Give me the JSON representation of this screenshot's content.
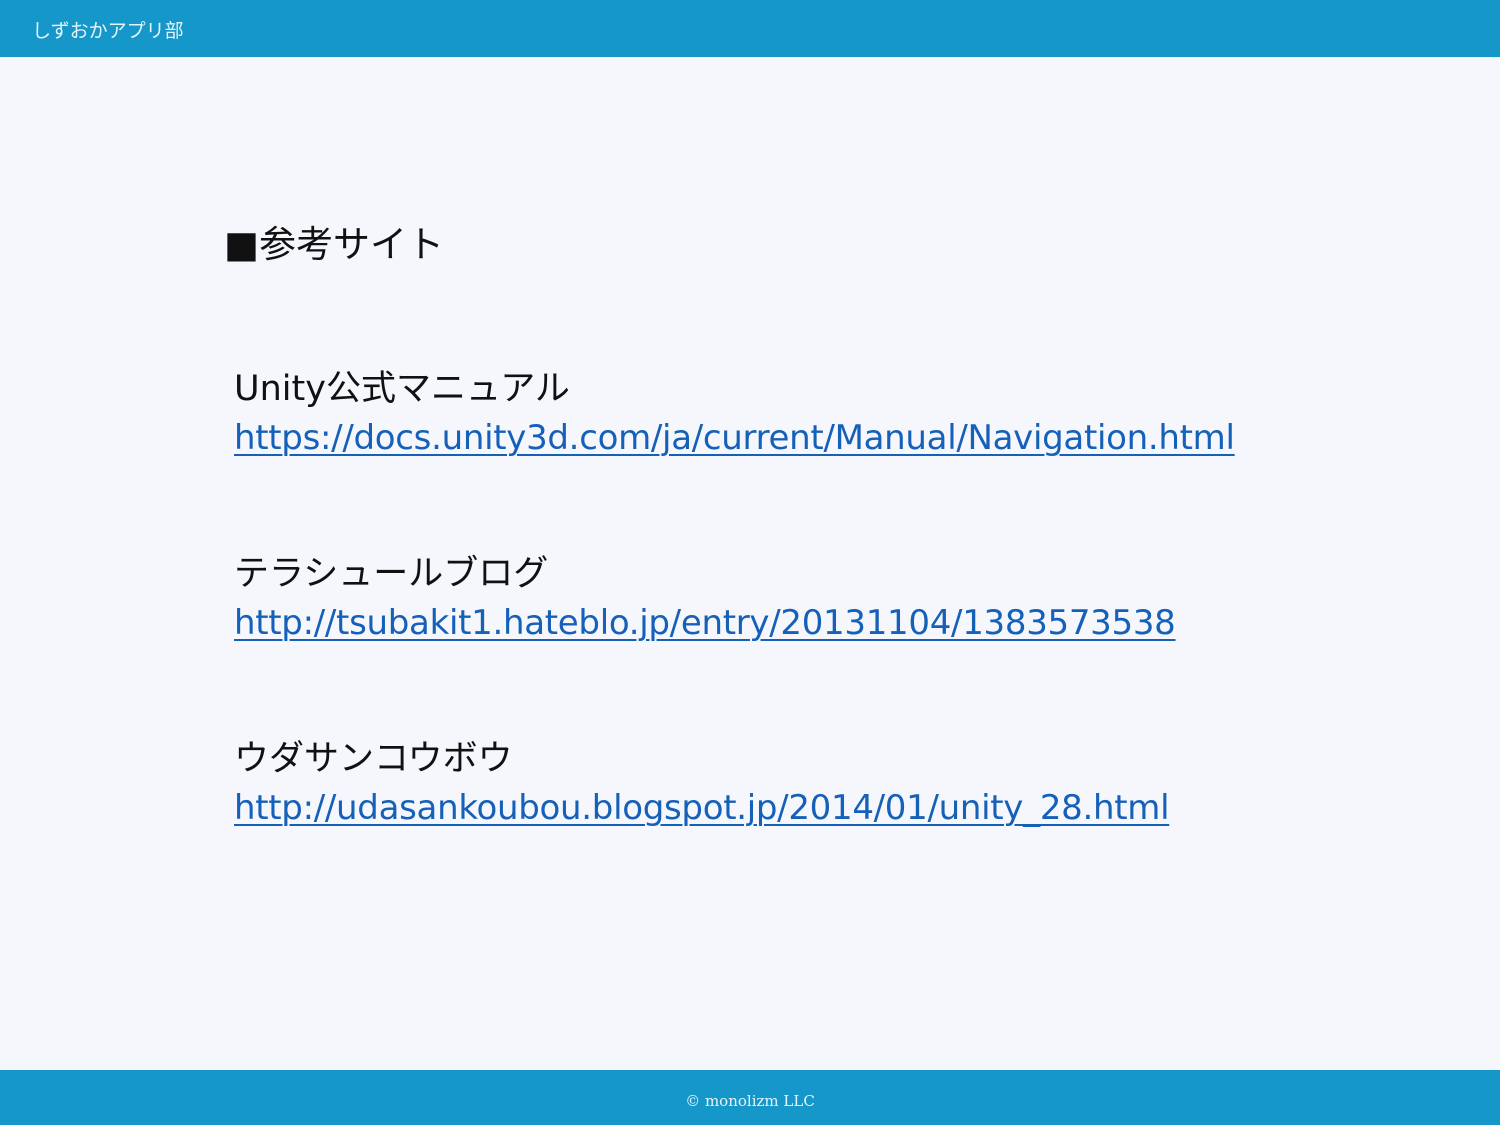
{
  "header": {
    "title": "しずおかアプリ部"
  },
  "main": {
    "heading": "■参考サイト",
    "references": [
      {
        "name": "Unity公式マニュアル",
        "url": "https://docs.unity3d.com/ja/current/Manual/Navigation.html"
      },
      {
        "name": "テラシュールブログ",
        "url": "http://tsubakit1.hateblo.jp/entry/20131104/1383573538"
      },
      {
        "name": "ウダサンコウボウ",
        "url": "http://udasankoubou.blogspot.jp/2014/01/unity_28.html"
      }
    ]
  },
  "footer": {
    "copyright": "© monolizm LLC"
  },
  "colors": {
    "bar": "#1597c9",
    "background": "#f5f7fd",
    "link": "#1560b8",
    "text": "#111111"
  }
}
